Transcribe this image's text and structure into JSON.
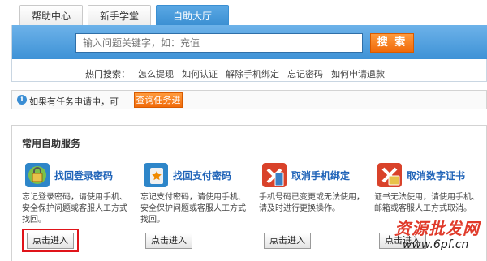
{
  "tabs": [
    {
      "label": "帮助中心"
    },
    {
      "label": "新手学堂"
    },
    {
      "label": "自助大厅"
    }
  ],
  "search": {
    "placeholder": "输入问题关键字，如：充值",
    "button_label": "搜 索"
  },
  "hot_search": {
    "label": "热门搜索：",
    "links": [
      "怎么提现",
      "如何认证",
      "解除手机绑定",
      "忘记密码",
      "如何申请退款"
    ]
  },
  "notice": {
    "text": "如果有任务申请中，可",
    "button_label": "查询任务进度"
  },
  "services": {
    "title": "常用自助服务",
    "cards": [
      {
        "title": "找回登录密码",
        "desc": "忘记登录密码，请使用手机、安全保护问题或客服人工方式找回。",
        "button_label": "点击进入",
        "icon": "lock-icon"
      },
      {
        "title": "找回支付密码",
        "desc": "忘记支付密码，请使用手机、安全保护问题或客服人工方式找回。",
        "button_label": "点击进入",
        "icon": "star-key-icon"
      },
      {
        "title": "取消手机绑定",
        "desc": "手机号码已变更或无法使用，请及时进行更换操作。",
        "button_label": "点击进入",
        "icon": "phone-cancel-icon"
      },
      {
        "title": "取消数字证书",
        "desc": "证书无法使用，请使用手机、邮箱或客服人工方式取消。",
        "button_label": "点击进入",
        "icon": "certificate-cancel-icon"
      }
    ]
  },
  "watermark": {
    "title": "资源批发网",
    "url": "www.6pf.cn"
  },
  "colors": {
    "accent_blue": "#3e92d6",
    "orange": "#f06a0a",
    "link_blue": "#1f63b8",
    "highlight_red": "#e0141a"
  }
}
